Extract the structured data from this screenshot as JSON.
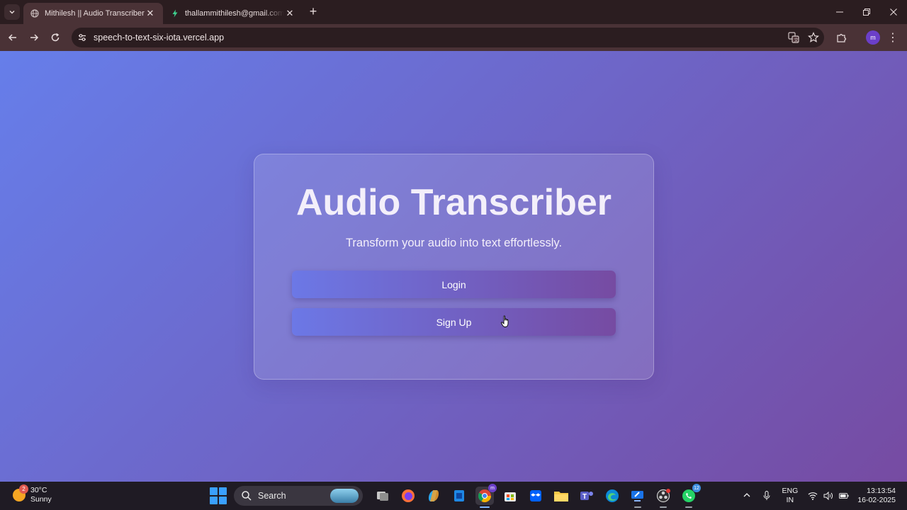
{
  "browser": {
    "tabs": [
      {
        "title": "Mithilesh || Audio Transcriber",
        "active": true,
        "favicon": "globe-icon"
      },
      {
        "title": "thallammithilesh@gmail.com's",
        "active": false,
        "favicon": "bolt-icon"
      }
    ],
    "url": "speech-to-text-six-iota.vercel.app",
    "profile_initial": "m"
  },
  "page": {
    "title": "Audio Transcriber",
    "subtitle": "Transform your audio into text effortlessly.",
    "login_label": "Login",
    "signup_label": "Sign Up",
    "colors": {
      "gradient_start": "#667eea",
      "gradient_end": "#764ba2"
    }
  },
  "taskbar": {
    "weather": {
      "temp": "30°C",
      "condition": "Sunny",
      "badge": "2"
    },
    "search_label": "Search",
    "whatsapp_badge": "12",
    "chrome_badge": "m",
    "lang_line1": "ENG",
    "lang_line2": "IN",
    "time": "13:13:54",
    "date": "16-02-2025"
  }
}
